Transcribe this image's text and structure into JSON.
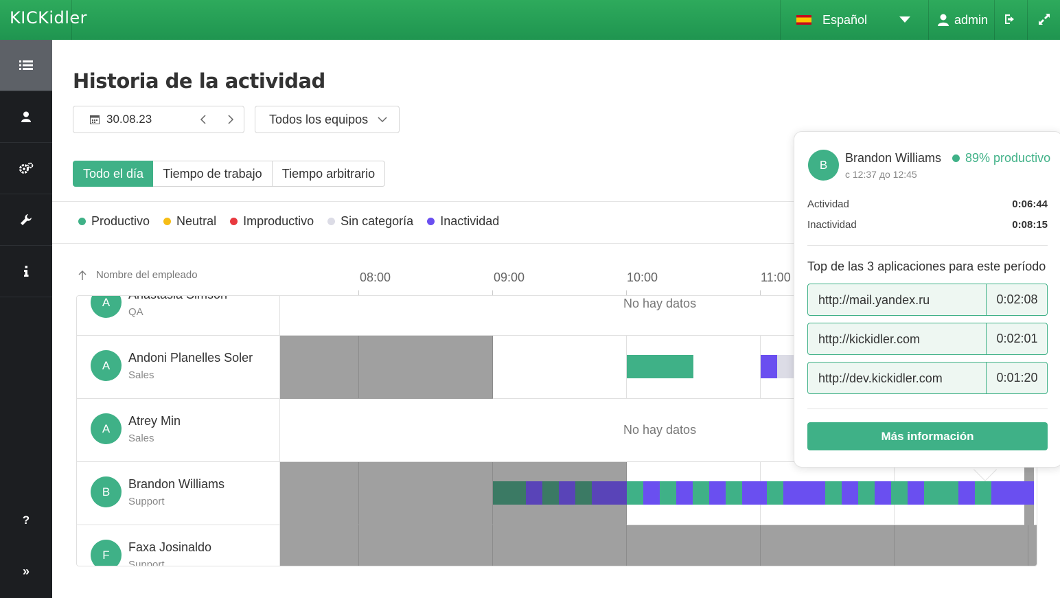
{
  "app": {
    "logo": "KICKidler"
  },
  "topbar": {
    "language": "Español",
    "user": "admin"
  },
  "sidebar": {
    "items": [
      "list-icon",
      "user-icon",
      "gears-icon",
      "wrench-icon",
      "info-icon",
      "help-icon",
      "expand-icon"
    ]
  },
  "page": {
    "title": "Historia de la actividad",
    "date": "30.08.23",
    "team": "Todos los equipos",
    "tabs": [
      "Todo el día",
      "Tiempo de trabajo",
      "Tiempo arbitrario"
    ],
    "active_tab": "Todo el día"
  },
  "legend": [
    {
      "label": "Productivo",
      "color": "#3fb187"
    },
    {
      "label": "Neutral",
      "color": "#f6bd16"
    },
    {
      "label": "Improductivo",
      "color": "#e8393f"
    },
    {
      "label": "Sin categoría",
      "color": "#dcdce6"
    },
    {
      "label": "Inactividad",
      "color": "#6a4ff0"
    }
  ],
  "table": {
    "column_header": "Nombre del empleado",
    "times": [
      "08:00",
      "09:00",
      "10:00",
      "11:00"
    ],
    "no_data": "No hay datos",
    "rows": [
      {
        "initial": "A",
        "name": "Anastasia Simson",
        "dept": "QA"
      },
      {
        "initial": "A",
        "name": "Andoni Planelles Soler",
        "dept": "Sales"
      },
      {
        "initial": "A",
        "name": "Atrey Min",
        "dept": "Sales"
      },
      {
        "initial": "B",
        "name": "Brandon Williams",
        "dept": "Support"
      },
      {
        "initial": "F",
        "name": "Faxa Josinaldo",
        "dept": "Support"
      }
    ]
  },
  "popup": {
    "initial": "B",
    "name": "Brandon Williams",
    "productivity": "89% productivo",
    "range": "с 12:37 до 12:45",
    "activity_label": "Actividad",
    "activity_value": "0:06:44",
    "inactivity_label": "Inactividad",
    "inactivity_value": "0:08:15",
    "top_title": "Top de las 3 aplicaciones para este período",
    "apps": [
      {
        "url": "http://mail.yandex.ru",
        "time": "0:02:08"
      },
      {
        "url": "http://kickidler.com",
        "time": "0:02:01"
      },
      {
        "url": "http://dev.kickidler.com",
        "time": "0:01:20"
      }
    ],
    "more_button": "Más información"
  },
  "colors": {
    "brand_green": "#2eaa5c",
    "productive": "#3fb187",
    "inactive": "#6a4ff0",
    "offline_gray": "#a0a0a0"
  }
}
